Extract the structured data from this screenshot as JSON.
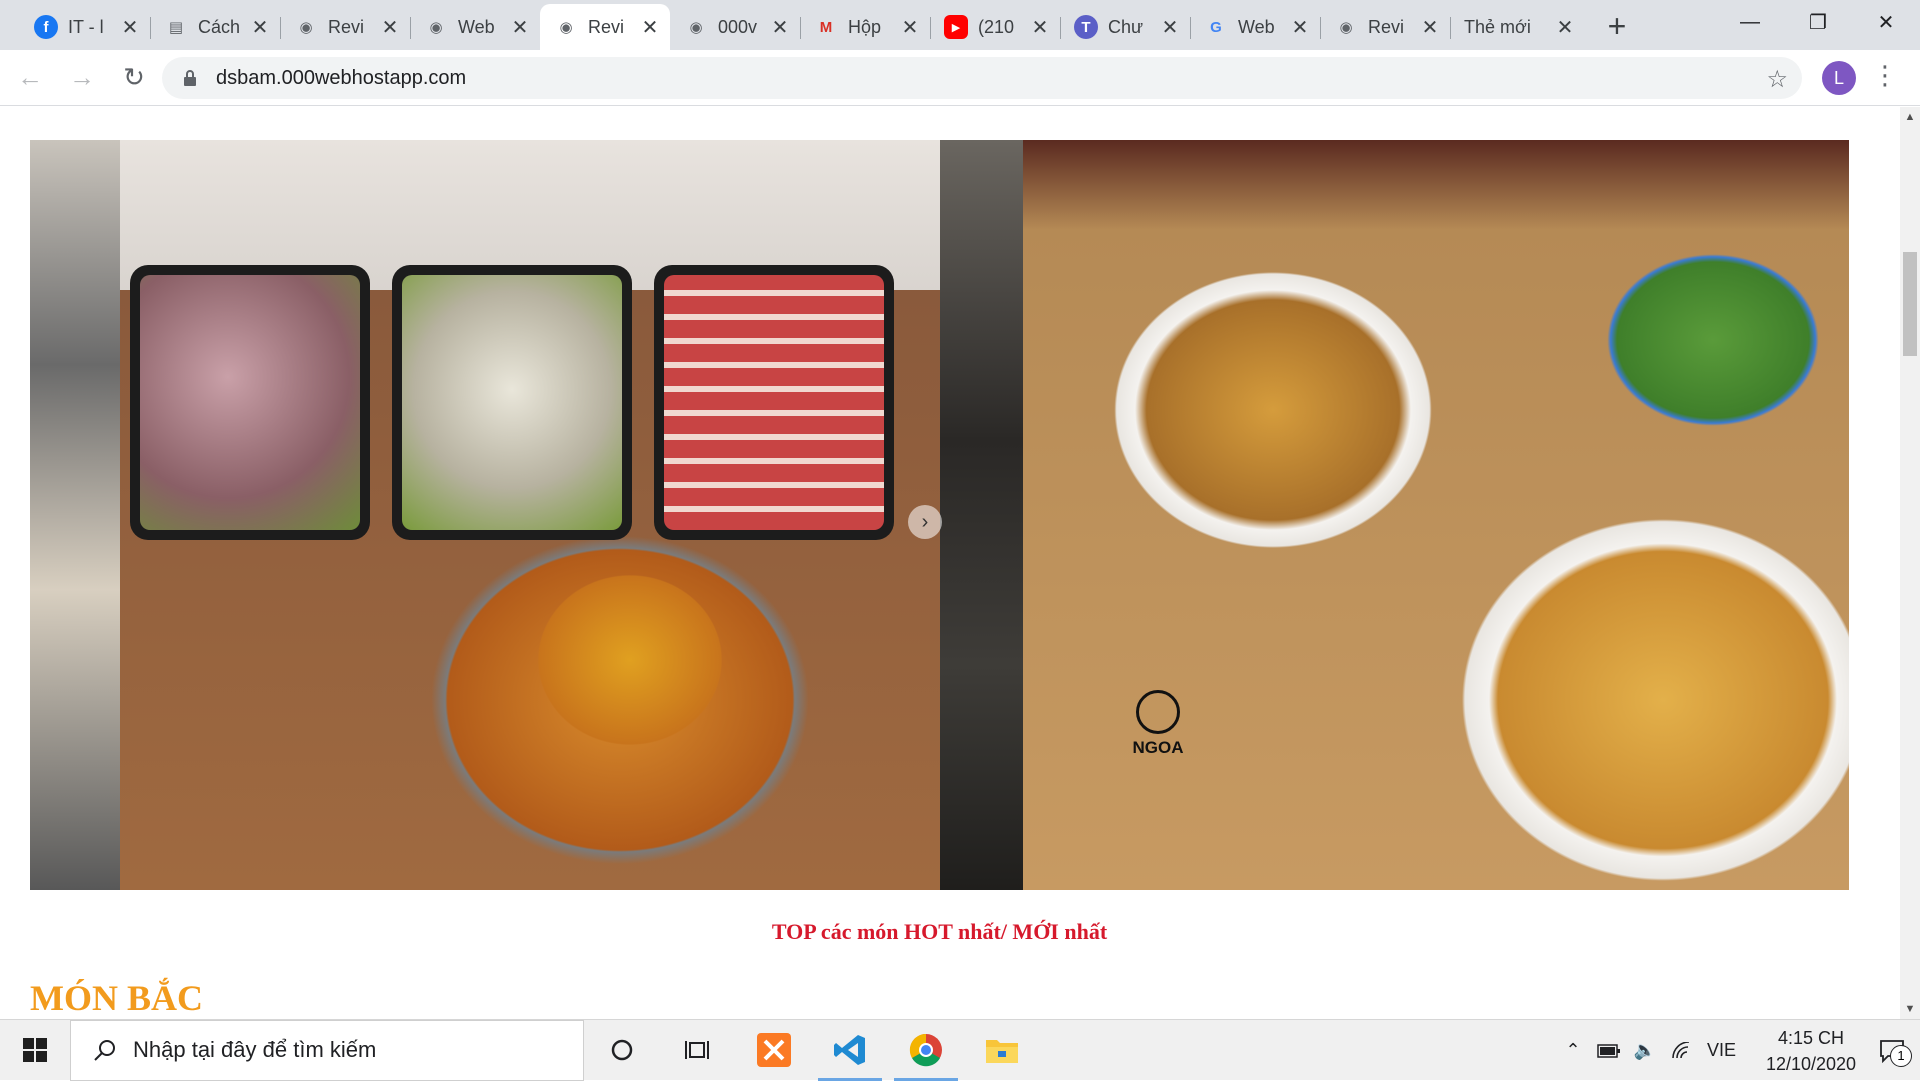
{
  "browser": {
    "tabs": [
      {
        "title": "IT - l",
        "icon": "facebook-icon",
        "color": "#1877f2"
      },
      {
        "title": "Cách",
        "icon": "document-icon",
        "color": "#5f6368"
      },
      {
        "title": "Revi",
        "icon": "globe-icon",
        "color": "#5f6368"
      },
      {
        "title": "Web",
        "icon": "globe-icon",
        "color": "#5f6368"
      },
      {
        "title": "Revi",
        "icon": "globe-icon",
        "color": "#5f6368",
        "active": true
      },
      {
        "title": "000v",
        "icon": "globe-icon",
        "color": "#5f6368"
      },
      {
        "title": "Hộp",
        "icon": "gmail-icon",
        "color": "#d93025"
      },
      {
        "title": "(210",
        "icon": "youtube-icon",
        "color": "#ff0000"
      },
      {
        "title": "Chư",
        "icon": "teams-icon",
        "color": "#5b5fc7"
      },
      {
        "title": "Web",
        "icon": "google-icon",
        "color": "#4285f4"
      },
      {
        "title": "Revi",
        "icon": "globe-icon",
        "color": "#5f6368"
      },
      {
        "title": "Thẻ mới",
        "icon": "none"
      }
    ],
    "url": "dsbam.000webhostapp.com",
    "profile_initial": "L"
  },
  "page": {
    "hot_title": "TOP các món HOT nhất/ MỚI nhất",
    "section_title": "MÓN BẮC",
    "watermark": "NGOA",
    "accent_orange": "#f29b1d",
    "accent_red": "#d6192c"
  },
  "taskbar": {
    "search_placeholder": "Nhập tại đây để tìm kiếm",
    "language": "VIE",
    "time": "4:15 CH",
    "date": "12/10/2020",
    "notification_count": "1"
  }
}
